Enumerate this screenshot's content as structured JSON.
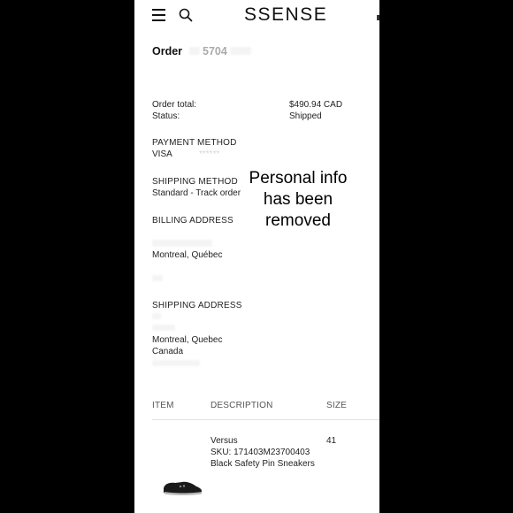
{
  "header": {
    "brand": "SSENSE"
  },
  "order": {
    "title_prefix": "Order",
    "number_fragment": "5704",
    "total_label": "Order total:",
    "total_value": "$490.94 CAD",
    "status_label": "Status:",
    "status_value": "Shipped"
  },
  "payment": {
    "heading": "PAYMENT METHOD",
    "card": "VISA",
    "masked": "******"
  },
  "shipping_method": {
    "heading": "SHIPPING METHOD",
    "value": "Standard - Track order"
  },
  "billing": {
    "heading": "BILLING ADDRESS",
    "city": "Montreal, Québec"
  },
  "shipping_address": {
    "heading": "SHIPPING ADDRESS",
    "city": "Montreal, Quebec",
    "country": "Canada"
  },
  "overlay_note": "Personal info has been removed",
  "items_table": {
    "headers": [
      "ITEM",
      "DESCRIPTION",
      "SIZE"
    ],
    "rows": [
      {
        "brand": "Versus",
        "sku": "SKU: 171403M23700403",
        "name": "Black Safety Pin Sneakers",
        "size": "41",
        "image_icon": "sneaker-icon"
      }
    ]
  },
  "icons": {
    "menu": "menu-icon",
    "search": "search-icon"
  },
  "colors": {
    "background": "#000000",
    "panel": "#ffffff",
    "text": "#111111"
  }
}
